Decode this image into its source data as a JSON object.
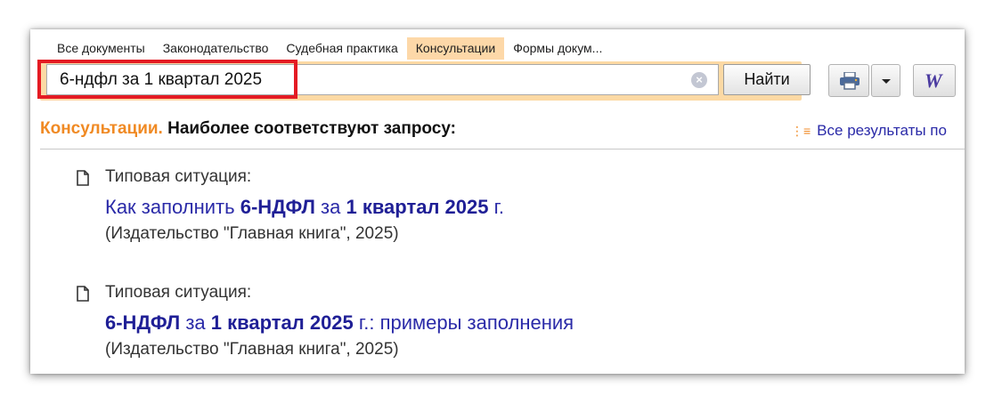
{
  "tabs": [
    {
      "label": "Все документы",
      "active": false
    },
    {
      "label": "Законодательство",
      "active": false
    },
    {
      "label": "Судебная практика",
      "active": false
    },
    {
      "label": "Консультации",
      "active": true
    },
    {
      "label": "Формы докум..."
    }
  ],
  "search": {
    "value": "6-ндфл за 1 квартал 2025",
    "button_label": "Найти",
    "clear_icon": "clear-icon"
  },
  "toolbar": {
    "print_icon": "printer-icon",
    "dropdown_icon": "chevron-down-icon",
    "word_label": "W"
  },
  "heading": {
    "category": "Консультации.",
    "description": "Наиболее соответствуют запросу:"
  },
  "all_results_label": "Все результаты по",
  "results": [
    {
      "type": "Типовая ситуация:",
      "title_parts": [
        {
          "text": "Как заполнить ",
          "bold": false
        },
        {
          "text": "6-НДФЛ",
          "bold": true
        },
        {
          "text": " за ",
          "bold": false
        },
        {
          "text": "1 квартал 2025",
          "bold": true
        },
        {
          "text": " г.",
          "bold": false
        }
      ],
      "source": "(Издательство \"Главная книга\", 2025)"
    },
    {
      "type": "Типовая ситуация:",
      "title_parts": [
        {
          "text": "6-НДФЛ",
          "bold": true
        },
        {
          "text": " за ",
          "bold": false
        },
        {
          "text": "1 квартал 2025",
          "bold": true
        },
        {
          "text": " г.: примеры заполнения",
          "bold": false
        }
      ],
      "source": "(Издательство \"Главная книга\", 2025)"
    }
  ],
  "colors": {
    "accent_orange": "#f08a24",
    "link_blue": "#2a2aa8",
    "search_bar_bg": "#fcd9a4",
    "highlight_red": "#e41b23"
  }
}
